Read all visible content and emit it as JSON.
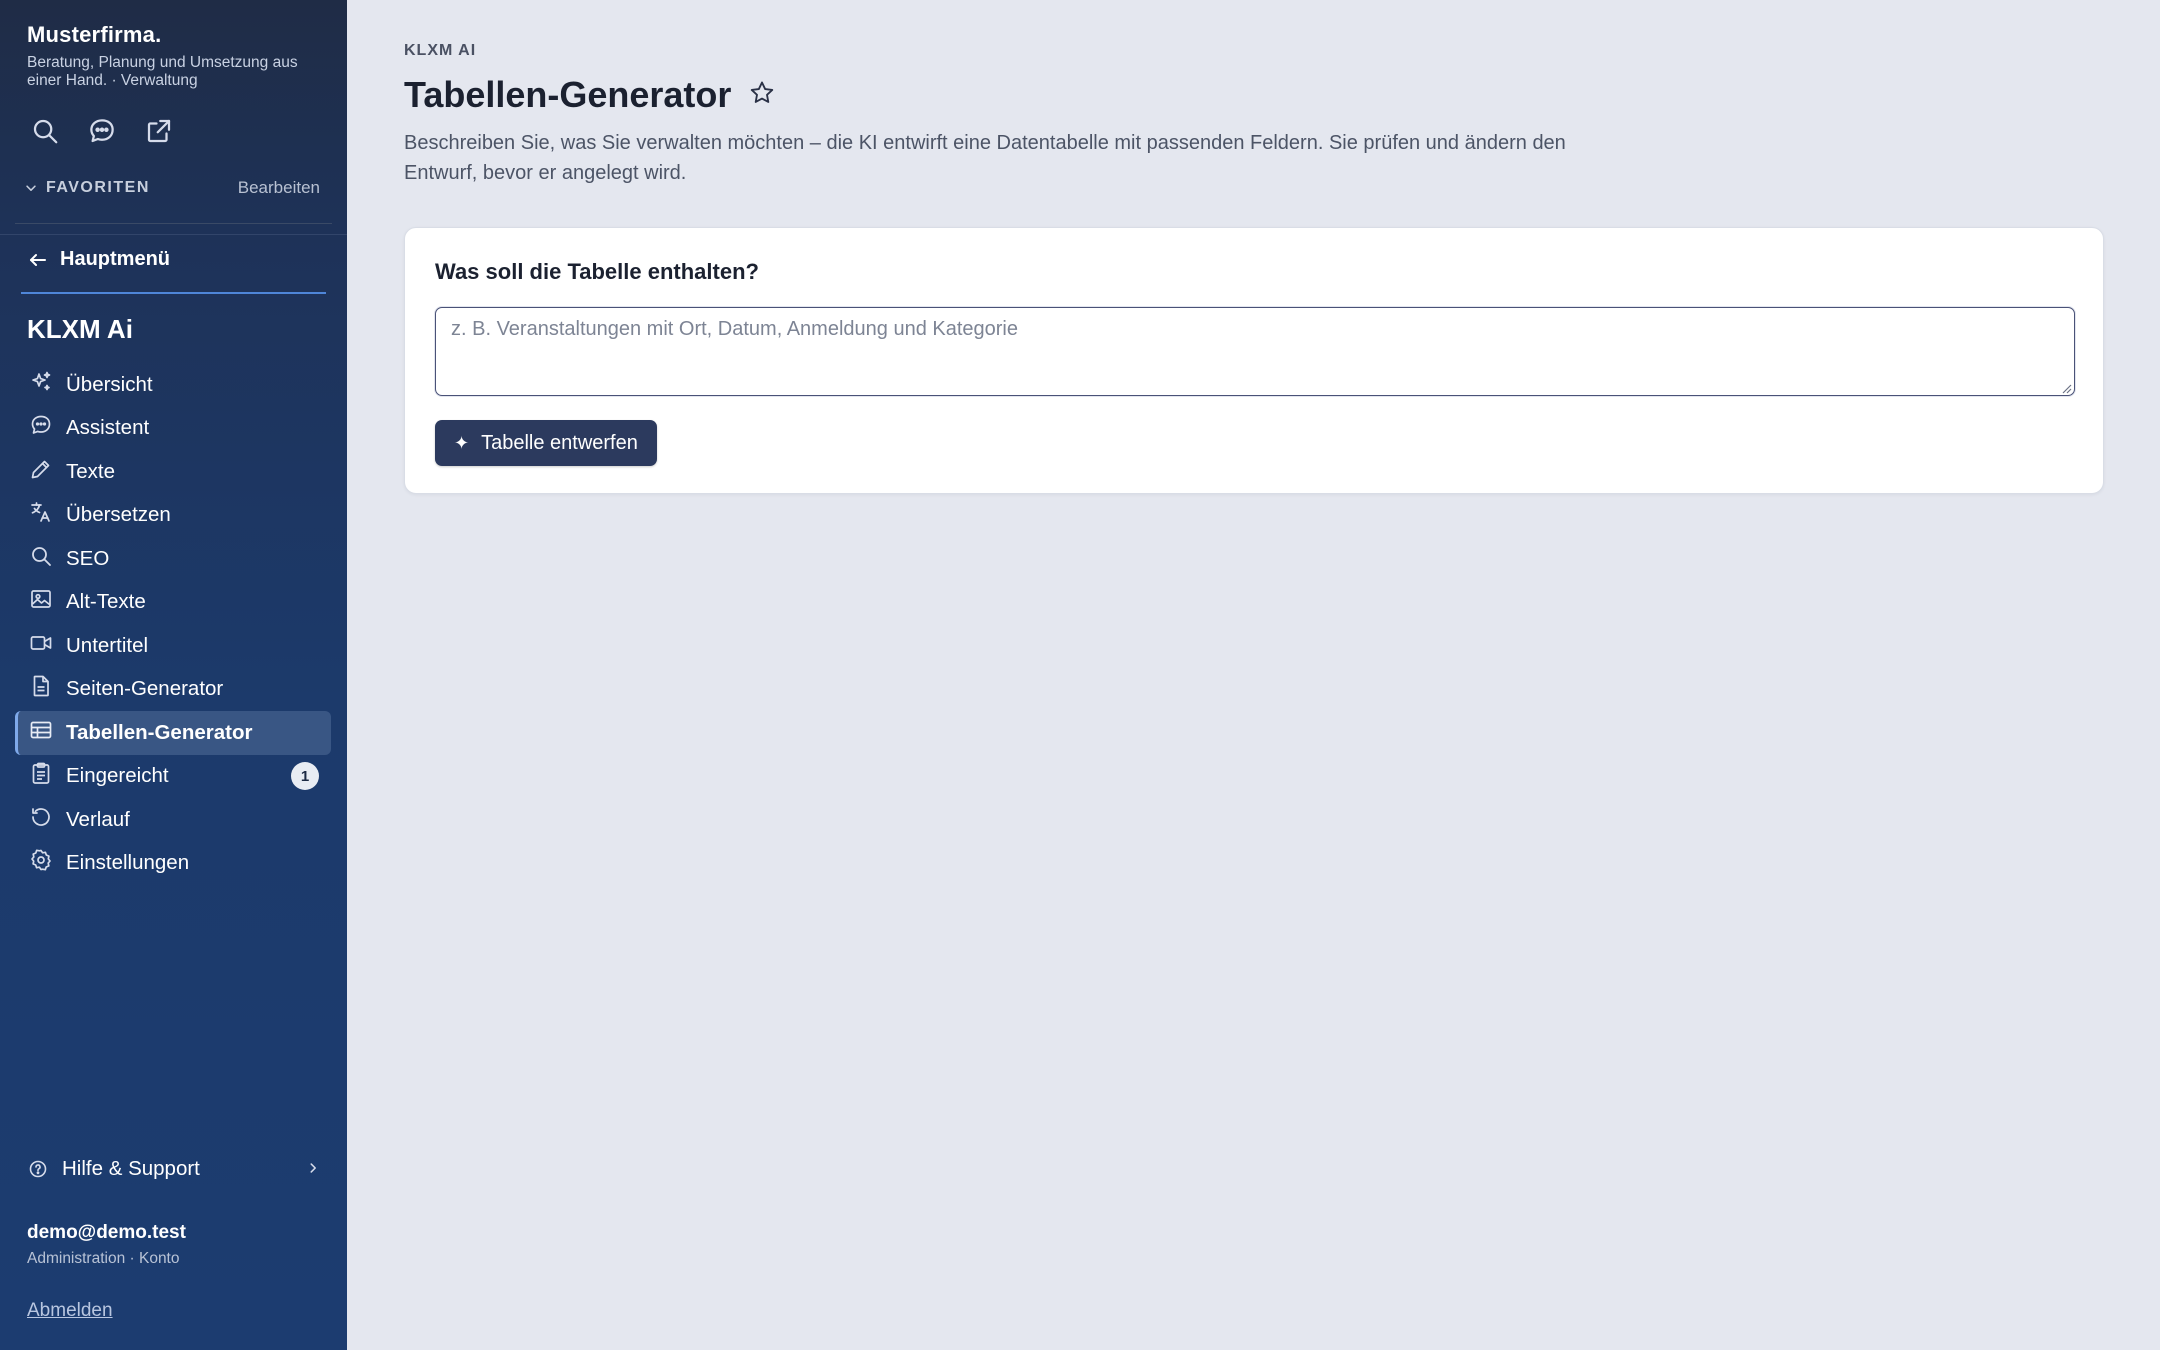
{
  "sidebar": {
    "brand_name": "Musterfirma.",
    "brand_subtitle": "Beratung, Planung und Umsetzung aus einer Hand. · Verwaltung",
    "tool_icons": [
      "search-icon",
      "chat-icon",
      "external-link-icon"
    ],
    "favorites_label": "FAVORITEN",
    "favorites_edit": "Bearbeiten",
    "back_label": "Hauptmenü",
    "section_title": "KLXM Ai",
    "items": [
      {
        "label": "Übersicht",
        "icon": "sparkles-icon",
        "active": false
      },
      {
        "label": "Assistent",
        "icon": "chat-bubble-icon",
        "active": false
      },
      {
        "label": "Texte",
        "icon": "pencil-icon",
        "active": false
      },
      {
        "label": "Übersetzen",
        "icon": "translate-icon",
        "active": false
      },
      {
        "label": "SEO",
        "icon": "magnifier-icon",
        "active": false
      },
      {
        "label": "Alt-Texte",
        "icon": "image-icon",
        "active": false
      },
      {
        "label": "Untertitel",
        "icon": "video-icon",
        "active": false
      },
      {
        "label": "Seiten-Generator",
        "icon": "document-icon",
        "active": false
      },
      {
        "label": "Tabellen-Generator",
        "icon": "table-icon",
        "active": true
      },
      {
        "label": "Eingereicht",
        "icon": "clipboard-icon",
        "active": false,
        "badge": "1"
      },
      {
        "label": "Verlauf",
        "icon": "history-icon",
        "active": false
      },
      {
        "label": "Einstellungen",
        "icon": "gear-icon",
        "active": false
      }
    ],
    "help_label": "Hilfe & Support",
    "user_email": "demo@demo.test",
    "user_role": "Administration · Konto",
    "logout_label": "Abmelden"
  },
  "main": {
    "eyebrow": "KLXM AI",
    "title": "Tabellen-Generator",
    "description": "Beschreiben Sie, was Sie verwalten möchten – die KI entwirft eine Datentabelle mit passenden Feldern. Sie prüfen und ändern den Entwurf, bevor er angelegt wird.",
    "card": {
      "label": "Was soll die Tabelle enthalten?",
      "input_value": "",
      "input_placeholder": "z. B. Veranstaltungen mit Ort, Datum, Anmeldung und Kategorie",
      "button_icon": "✦",
      "button_label": "Tabelle entwerfen"
    }
  },
  "colors": {
    "sidebar_bg": "#1c3a6b",
    "active_item_bg": "#395684",
    "page_bg": "#e4e7ef",
    "primary_button": "#2c3a5e"
  }
}
